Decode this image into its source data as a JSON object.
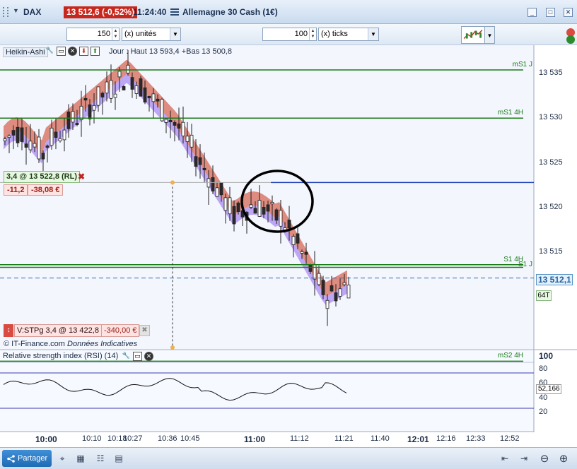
{
  "titlebar": {
    "instrument": "DAX",
    "price": "13 512,6 (-0,52%)",
    "time": "11:24:40",
    "name": "Allemagne 30 Cash (1€)",
    "dropdown_glyph": "▼",
    "menu_icon": "list-icon",
    "window_buttons": [
      "_",
      "□",
      "✕"
    ]
  },
  "toolbar": {
    "quantity_value": "150",
    "quantity_unit": "(x) unités",
    "ticks_value": "100",
    "ticks_unit": "(x) ticks",
    "chart_type_icon": "candlestick-chart-icon"
  },
  "indicator": {
    "name": "Heikin-Ashi",
    "ohlc_text": "Jour : Haut 13 593,4 +Bas 13 500,8"
  },
  "position": {
    "label": "3,4 @ 13 522,8 (RL)",
    "close_glyph": "✖",
    "pnl_points": "-11,2",
    "pnl_eur": "-38,08 €"
  },
  "stop_order": {
    "icon_glyph": "↕",
    "label": "V:STPg  3,4 @ 13 422,8",
    "pnl": "-340,00 €",
    "close_glyph": "✖"
  },
  "copyright": {
    "source": "© IT-Finance.com",
    "note": "Données Indicatives"
  },
  "price_axis": {
    "labels": [
      {
        "text": "13 535",
        "value": 13535
      },
      {
        "text": "13 530",
        "value": 13530
      },
      {
        "text": "13 525",
        "value": 13525
      },
      {
        "text": "13 520",
        "value": 13520
      },
      {
        "text": "13 515",
        "value": 13515
      }
    ],
    "partial_label": "10",
    "current_price": "13 512,1",
    "volume_tag": "64T"
  },
  "levels": [
    {
      "label": "mS1 J",
      "value": 13535.4,
      "color": "#1a7a18"
    },
    {
      "label": "mS1 4H",
      "value": 13530,
      "color": "#1a7a18"
    },
    {
      "label": "S1 4H",
      "value": 13513.6,
      "color": "#1a7a18"
    },
    {
      "label": "S1 J",
      "value": 13513.3,
      "color": "#1a7a18"
    },
    {
      "label": "mS2 4H",
      "value": 13502.8,
      "color": "#1a7a18"
    }
  ],
  "rsi": {
    "label": "Relative strength index (RSI) (14)",
    "axis": [
      "100",
      "80",
      "60",
      "40",
      "20"
    ],
    "value": "52,166"
  },
  "time_axis": [
    {
      "text": "10:00",
      "bold": true
    },
    {
      "text": "10:10",
      "bold": false
    },
    {
      "text": "10:18",
      "bold": false
    },
    {
      "text": "10:27",
      "bold": false
    },
    {
      "text": "10:36",
      "bold": false
    },
    {
      "text": "10:45",
      "bold": false
    },
    {
      "text": "11:00",
      "bold": true
    },
    {
      "text": "11:12",
      "bold": false
    },
    {
      "text": "11:21",
      "bold": false
    },
    {
      "text": "11:40",
      "bold": false
    },
    {
      "text": "12:01",
      "bold": true
    },
    {
      "text": "12:16",
      "bold": false
    },
    {
      "text": "12:33",
      "bold": false
    },
    {
      "text": "12:52",
      "bold": false
    }
  ],
  "bottombar": {
    "share_label": "Partager"
  },
  "colors": {
    "upper_band": "#d9786a",
    "lower_band": "#a98bf2",
    "level_line": "#1a7a18",
    "entry_line": "#1f3fb8",
    "price_dashed": "#2e6ea8",
    "price_red": "#c8271d"
  }
}
